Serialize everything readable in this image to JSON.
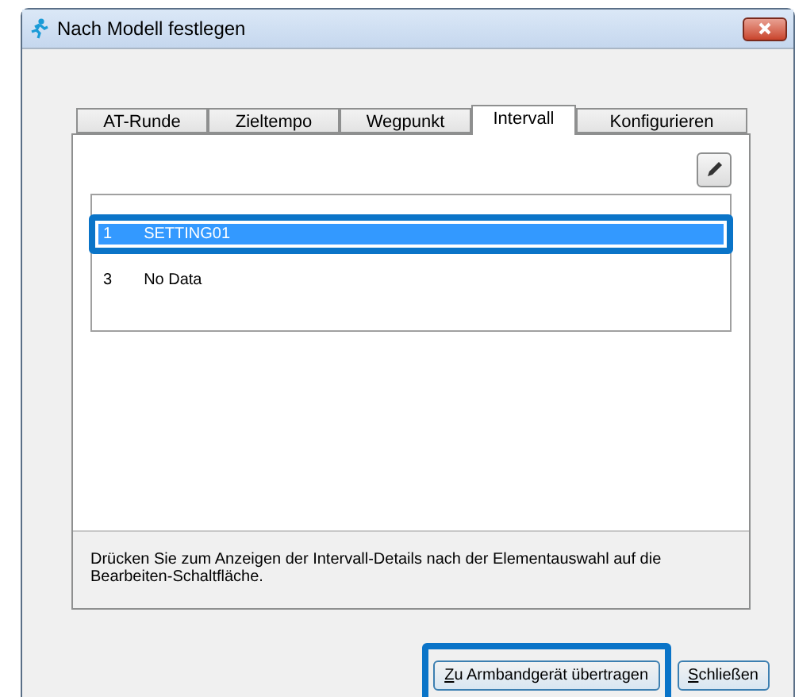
{
  "window": {
    "title": "Nach Modell festlegen"
  },
  "tabs": [
    {
      "label": "AT-Runde",
      "selected": false
    },
    {
      "label": "Zieltempo",
      "selected": false
    },
    {
      "label": "Wegpunkt",
      "selected": false
    },
    {
      "label": "Intervall",
      "selected": true
    },
    {
      "label": "Konfigurieren",
      "selected": false
    }
  ],
  "list": {
    "rows": [
      {
        "number": "1",
        "title": "SETTING01",
        "selected": true,
        "highlighted": true
      },
      {
        "number": "3",
        "title": "No Data",
        "selected": false,
        "highlighted": false
      }
    ]
  },
  "hint": "Drücken Sie zum Anzeigen der Intervall-Details nach der Elementauswahl auf die Bearbeiten-Schaltfläche.",
  "buttons": [
    {
      "label": "Zu Armbandgerät übertragen",
      "highlighted": true
    },
    {
      "label": "Schließen",
      "highlighted": false
    }
  ]
}
